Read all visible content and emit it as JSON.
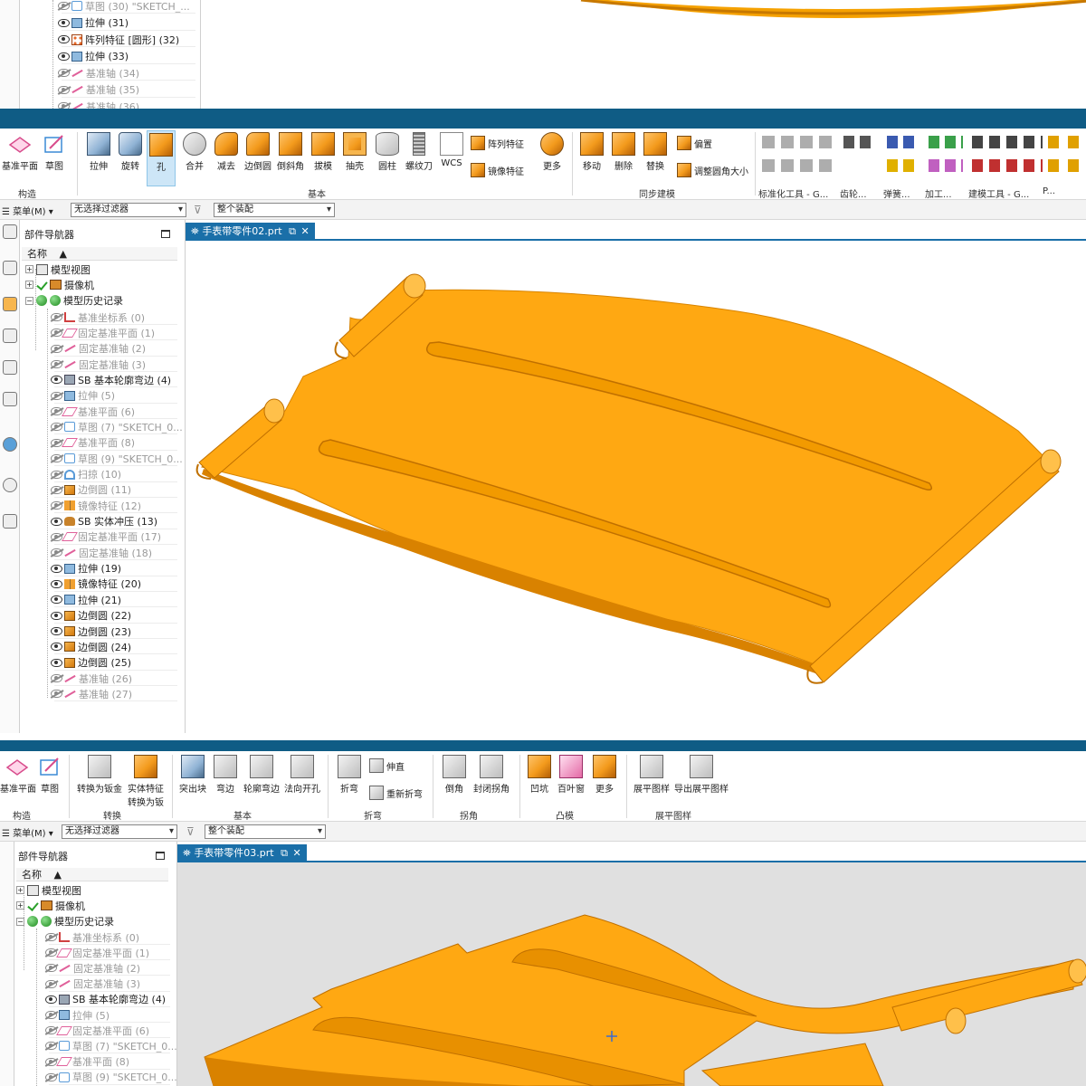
{
  "section1": {
    "tree": [
      {
        "label": "草图 (30) \"SKETCH_...",
        "dim": true,
        "icon": "sketch-icon"
      },
      {
        "label": "拉伸 (31)",
        "dim": false,
        "icon": "extrude-icon"
      },
      {
        "label": "阵列特征 [圆形] (32)",
        "dim": false,
        "icon": "pattern-icon"
      },
      {
        "label": "拉伸 (33)",
        "dim": false,
        "icon": "extrude-icon"
      },
      {
        "label": "基准轴 (34)",
        "dim": true,
        "icon": "datum-axis-icon"
      },
      {
        "label": "基准轴 (35)",
        "dim": true,
        "icon": "datum-axis-icon"
      },
      {
        "label": "基准轴 (36)",
        "dim": true,
        "icon": "datum-axis-icon"
      }
    ]
  },
  "section2": {
    "ribbon": {
      "groups": {
        "construct": "构造",
        "basic": "基本",
        "sync": "同步建模",
        "std_tools": "标准化工具 - G...",
        "gear": "齿轮...",
        "spring": "弹簧...",
        "machining": "加工...",
        "modeling_tools": "建模工具 - G...",
        "more": "P..."
      },
      "buttons": {
        "datum_plane": "基准平面",
        "sketch": "草图",
        "extrude": "拉伸",
        "revolve": "旋转",
        "hole": "孔",
        "unite": "合并",
        "subtract": "减去",
        "edge_blend": "边倒圆",
        "chamfer": "倒斜角",
        "draft": "拔模",
        "shell": "抽壳",
        "cylinder": "圆柱",
        "thread": "螺纹刀",
        "wcs": "WCS",
        "pattern_feature": "阵列特征",
        "mirror_feature": "镜像特征",
        "more": "更多",
        "move": "移动",
        "delete": "删除",
        "replace": "替换",
        "offset": "偏置",
        "resize_blend": "调整圆角大小"
      }
    },
    "filter": {
      "menu": "菜单(M)",
      "selection_filter": "无选择过滤器",
      "assembly_scope": "整个装配"
    },
    "doc_tab": "手表带零件02.prt",
    "navigator": {
      "title": "部件导航器",
      "col_name": "名称",
      "roots": [
        "模型视图",
        "摄像机",
        "模型历史记录"
      ],
      "items": [
        {
          "label": "基准坐标系 (0)",
          "dim": true
        },
        {
          "label": "固定基准平面 (1)",
          "dim": true
        },
        {
          "label": "固定基准轴 (2)",
          "dim": true
        },
        {
          "label": "固定基准轴 (3)",
          "dim": true
        },
        {
          "label": "SB 基本轮廓弯边 (4)",
          "dim": false
        },
        {
          "label": "拉伸 (5)",
          "dim": true
        },
        {
          "label": "基准平面 (6)",
          "dim": true
        },
        {
          "label": "草图 (7) \"SKETCH_0...",
          "dim": true
        },
        {
          "label": "基准平面 (8)",
          "dim": true
        },
        {
          "label": "草图 (9) \"SKETCH_0...",
          "dim": true
        },
        {
          "label": "扫掠 (10)",
          "dim": true
        },
        {
          "label": "边倒圆 (11)",
          "dim": true
        },
        {
          "label": "镜像特征 (12)",
          "dim": true
        },
        {
          "label": "SB 实体冲压 (13)",
          "dim": false
        },
        {
          "label": "固定基准平面 (17)",
          "dim": true
        },
        {
          "label": "固定基准轴 (18)",
          "dim": true
        },
        {
          "label": "拉伸 (19)",
          "dim": false
        },
        {
          "label": "镜像特征 (20)",
          "dim": false
        },
        {
          "label": "拉伸 (21)",
          "dim": false
        },
        {
          "label": "边倒圆 (22)",
          "dim": false
        },
        {
          "label": "边倒圆 (23)",
          "dim": false
        },
        {
          "label": "边倒圆 (24)",
          "dim": false
        },
        {
          "label": "边倒圆 (25)",
          "dim": false
        },
        {
          "label": "基准轴 (26)",
          "dim": true
        },
        {
          "label": "基准轴 (27)",
          "dim": true
        }
      ]
    }
  },
  "section3": {
    "ribbon": {
      "groups": {
        "construct": "构造",
        "convert": "转换",
        "basic": "基本",
        "fold": "折弯",
        "corner": "拐角",
        "punch": "凸模",
        "flat": "展平图样"
      },
      "buttons": {
        "datum_plane": "基准平面",
        "sketch": "草图",
        "convert_sheet": "转换为钣金",
        "solid_feature": "实体特征",
        "solid_feature_2": "转换为钣",
        "tab": "突出块",
        "flange": "弯边",
        "contour_flange": "轮廓弯边",
        "normal_cutout": "法向开孔",
        "bend": "折弯",
        "unbend": "伸直",
        "rebend": "重新折弯",
        "chamfer": "倒角",
        "closed_corner": "封闭拐角",
        "dimple": "凹坑",
        "louver": "百叶窗",
        "more": "更多",
        "flat_pattern": "展平图样",
        "export_flat": "导出展平图样"
      }
    },
    "filter": {
      "menu": "菜单(M)",
      "selection_filter": "无选择过滤器",
      "assembly_scope": "整个装配"
    },
    "doc_tab": "手表带零件03.prt",
    "navigator": {
      "title": "部件导航器",
      "col_name": "名称",
      "roots": [
        "模型视图",
        "摄像机",
        "模型历史记录"
      ],
      "items": [
        {
          "label": "基准坐标系 (0)",
          "dim": true
        },
        {
          "label": "固定基准平面 (1)",
          "dim": true
        },
        {
          "label": "固定基准轴 (2)",
          "dim": true
        },
        {
          "label": "固定基准轴 (3)",
          "dim": true
        },
        {
          "label": "SB 基本轮廓弯边 (4)",
          "dim": false
        },
        {
          "label": "拉伸 (5)",
          "dim": true
        },
        {
          "label": "固定基准平面 (6)",
          "dim": true
        },
        {
          "label": "草图 (7) \"SKETCH_0...",
          "dim": true
        },
        {
          "label": "基准平面 (8)",
          "dim": true
        },
        {
          "label": "草图 (9) \"SKETCH_0...",
          "dim": true
        }
      ]
    }
  },
  "colors": {
    "part_orange": "#ffa500",
    "title_bar": "#0f5c85",
    "tab_blue": "#1a6fa8",
    "viewport_grey": "#e0e0e0"
  }
}
